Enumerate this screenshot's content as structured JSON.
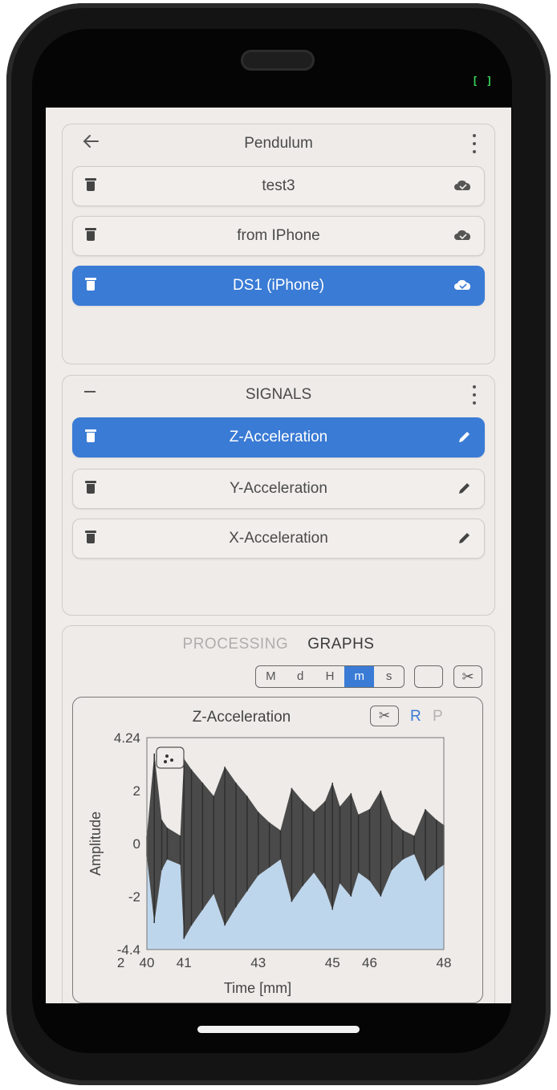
{
  "project": {
    "title": "Pendulum",
    "datasets": [
      {
        "label": "test3",
        "selected": false
      },
      {
        "label": "from IPhone",
        "selected": false
      },
      {
        "label": "DS1 (iPhone)",
        "selected": true
      }
    ]
  },
  "signals": {
    "title": "SIGNALS",
    "items": [
      {
        "label": "Z-Acceleration",
        "selected": true
      },
      {
        "label": "Y-Acceleration",
        "selected": false
      },
      {
        "label": "X-Acceleration",
        "selected": false
      }
    ]
  },
  "panel": {
    "tabs": [
      {
        "label": "PROCESSING",
        "active": false
      },
      {
        "label": "GRAPHS",
        "active": true
      }
    ],
    "time_units": [
      {
        "label": "M",
        "active": false
      },
      {
        "label": "d",
        "active": false
      },
      {
        "label": "H",
        "active": false
      },
      {
        "label": "m",
        "active": true
      },
      {
        "label": "s",
        "active": false
      }
    ]
  },
  "graph": {
    "title": "Z-Acceleration",
    "r_label": "R",
    "p_label": "P"
  },
  "colors": {
    "accent": "#3a7bd5",
    "signal": "#4a4a4a",
    "fill": "#b8d4ec"
  },
  "chart_data": {
    "type": "line",
    "title": "",
    "xlabel": "Time [mm]",
    "ylabel": "Amplitude",
    "ylim": [
      -4,
      4
    ],
    "y_ticks": [
      "4.24",
      "2",
      "0",
      "-2",
      "-4.4"
    ],
    "x_ticks": [
      "2",
      "40",
      "41",
      "43",
      "45",
      "46",
      "48"
    ],
    "series": [
      {
        "x": [
          40.0,
          40.2,
          40.4,
          40.55,
          40.9,
          41.0,
          41.2,
          41.5,
          41.8,
          42.1,
          42.4,
          42.7,
          43.0,
          43.3,
          43.6,
          43.9,
          44.2,
          44.5,
          44.8,
          45.0,
          45.2,
          45.5,
          45.7,
          46.0,
          46.3,
          46.6,
          46.9,
          47.2,
          47.5,
          47.8,
          48.0
        ],
        "upper": [
          0.3,
          3.4,
          0.9,
          0.6,
          0.3,
          3.2,
          2.8,
          2.3,
          1.8,
          2.9,
          2.3,
          1.8,
          1.2,
          0.8,
          0.5,
          2.1,
          1.6,
          1.2,
          1.6,
          2.3,
          1.4,
          1.9,
          1.1,
          1.3,
          2.0,
          0.9,
          0.5,
          0.3,
          1.3,
          0.9,
          0.7
        ],
        "lower": [
          -0.5,
          -3.0,
          -1.0,
          -0.6,
          -0.8,
          -3.6,
          -3.1,
          -2.5,
          -1.9,
          -3.1,
          -2.4,
          -1.8,
          -1.2,
          -0.9,
          -0.6,
          -2.2,
          -1.6,
          -1.1,
          -1.7,
          -2.5,
          -1.5,
          -2.0,
          -1.1,
          -1.4,
          -2.0,
          -1.0,
          -0.6,
          -0.4,
          -1.4,
          -1.0,
          -0.8
        ]
      }
    ]
  }
}
